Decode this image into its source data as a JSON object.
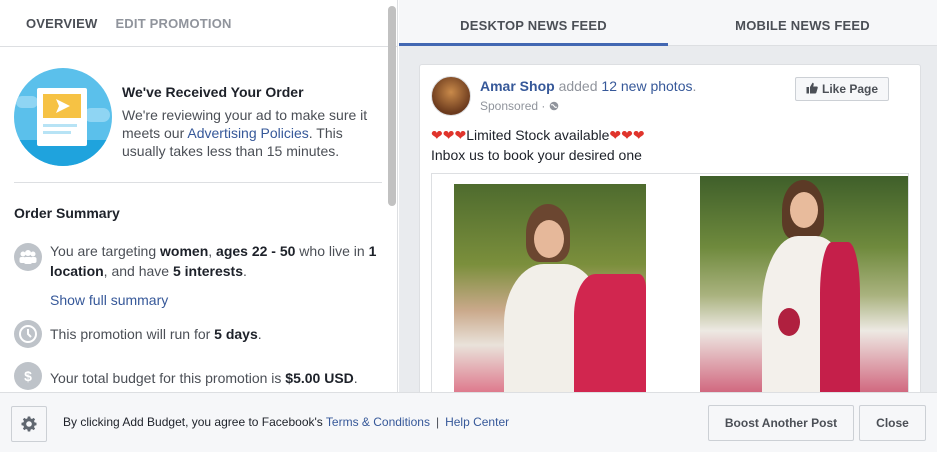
{
  "left_tabs": [
    "OVERVIEW",
    "EDIT PROMOTION"
  ],
  "received": {
    "title": "We've Received Your Order",
    "body_pre": "We're reviewing your ad to make sure it meets our ",
    "link": "Advertising Policies",
    "body_post": ". This usually takes less than 15 minutes."
  },
  "summary": {
    "title": "Order Summary",
    "targeting": {
      "t1": "You are targeting ",
      "b1": "women",
      "t2": ", ",
      "b2": "ages 22 - 50",
      "t3": " who live in ",
      "b3": "1 location",
      "t4": ", and have ",
      "b4": "5 interests",
      "t5": "."
    },
    "show_full": "Show full summary",
    "duration": {
      "t1": "This promotion will run for ",
      "b1": "5 days",
      "t2": "."
    },
    "budget": {
      "t1": "Your total budget for this promotion is ",
      "b1": "$5.00 USD",
      "t2": "."
    }
  },
  "right_tabs": [
    "DESKTOP NEWS FEED",
    "MOBILE NEWS FEED"
  ],
  "post": {
    "page_name": "Amar Shop",
    "added": " added ",
    "count_link": "12 new photos",
    "dot": ".",
    "sponsored": "Sponsored · ",
    "like_page": "Like Page",
    "line1_text": "Limited Stock available",
    "line2": "Inbox us to book your desired one"
  },
  "footer": {
    "text": "By clicking Add Budget, you agree to Facebook's ",
    "terms": "Terms & Conditions",
    "separator": "|",
    "help": "Help Center",
    "boost": "Boost Another Post",
    "close": "Close"
  },
  "colors": {
    "link": "#365899",
    "accent": "#4267b2",
    "heart": "#e0342c"
  }
}
